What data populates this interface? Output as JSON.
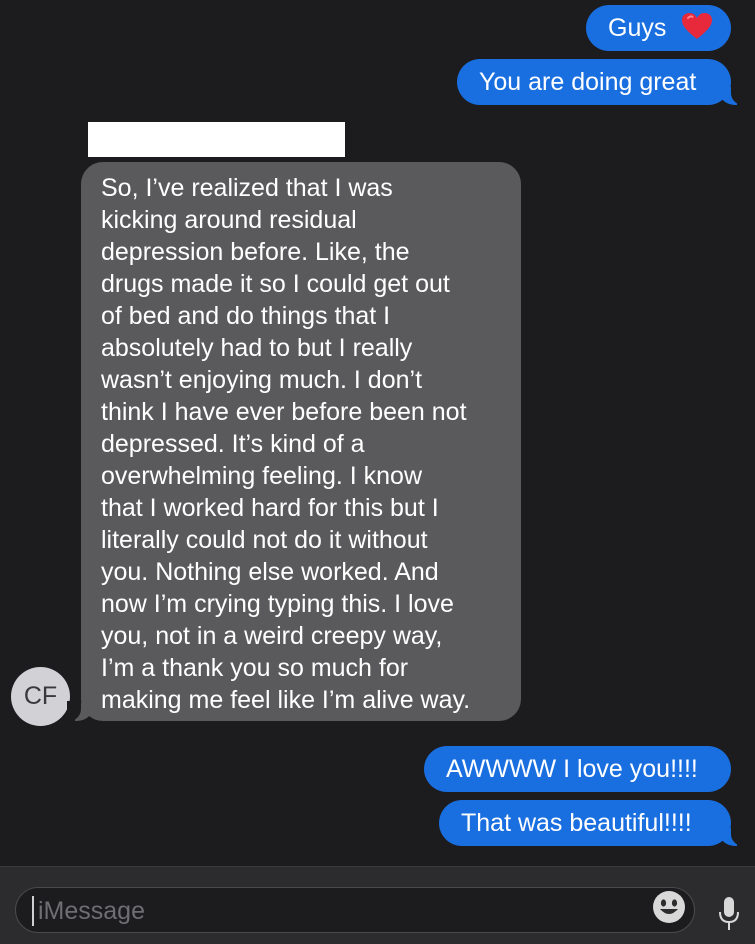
{
  "messages": {
    "guys": "Guys",
    "doing_great": "You are doing great",
    "incoming_lines": [
      "So, I’ve realized that I was",
      "kicking around residual",
      "depression before. Like, the",
      "drugs made it so I could get out",
      "of bed and do things that I",
      "absolutely had to but I really",
      "wasn’t enjoying much. I don’t",
      "think I have ever before been not",
      "depressed. It’s kind of a",
      "overwhelming feeling. I know",
      "that I worked hard for this but I",
      "literally could not do it without",
      "you. Nothing else worked. And",
      "now I’m crying typing this. I love",
      "you, not in a weird creepy way,",
      "I’m a thank you so much for",
      "making me feel like I’m alive way."
    ],
    "love_you": "AWWWW I love you!!!!",
    "beautiful": "That was beautiful!!!!"
  },
  "sender": {
    "initials": "CF"
  },
  "composer": {
    "placeholder": "iMessage"
  },
  "icons": {
    "heart": "red-heart-icon",
    "emoji": "emoji-icon",
    "mic": "microphone-icon"
  },
  "colors": {
    "outgoing": "#1a6fe0",
    "incoming": "#5a5a5c",
    "background": "#1c1c1e"
  }
}
